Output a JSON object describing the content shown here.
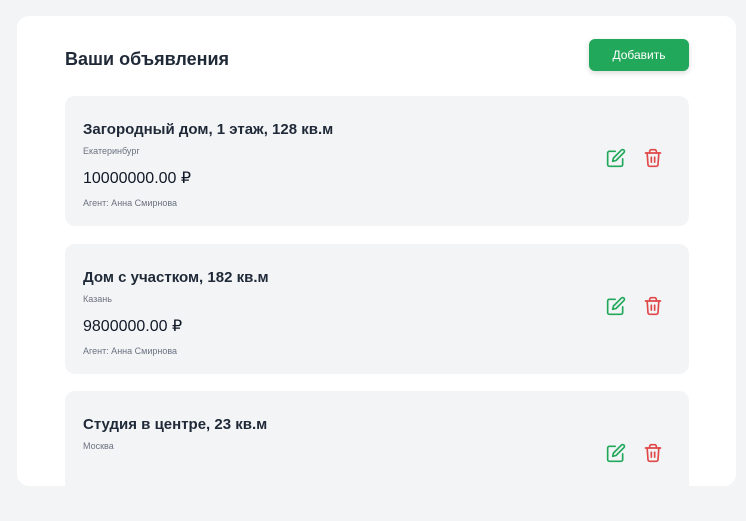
{
  "header": {
    "title": "Ваши объявления",
    "add_label": "Добавить"
  },
  "colors": {
    "accent": "#22a85a",
    "edit_icon": "#22a85a",
    "delete_icon": "#e04848",
    "card_bg": "#f3f4f6"
  },
  "listings": [
    {
      "title": "Загородный дом, 1 этаж, 128 кв.м",
      "city": "Екатеринбург",
      "price": "10000000.00 ₽",
      "agent": "Агент: Анна Смирнова"
    },
    {
      "title": "Дом с участком, 182 кв.м",
      "city": "Казань",
      "price": "9800000.00 ₽",
      "agent": "Агент: Анна Смирнова"
    },
    {
      "title": "Студия в центре, 23 кв.м",
      "city": "Москва",
      "price": "",
      "agent": ""
    }
  ],
  "icons": {
    "edit": "edit-icon",
    "delete": "trash-icon"
  }
}
